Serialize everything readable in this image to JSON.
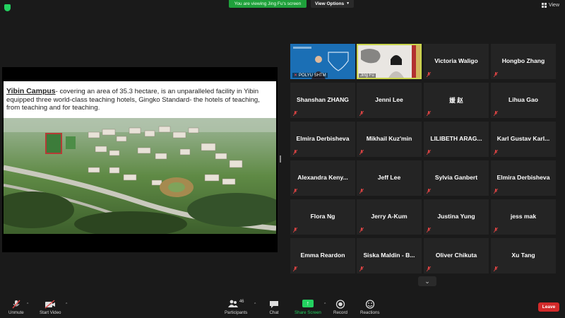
{
  "top_bar": {
    "viewing_banner": "You are viewing Jing Fu's screen",
    "view_options": "View Options",
    "view_label": "View"
  },
  "shared_screen": {
    "slide_title": "Yibin Campus",
    "slide_body": "- covering an area of 35.3 hectare, is an unparalleled facility in Yibin equipped three world-class teaching hotels, Gingko Standard- the hotels of teaching, from teaching and for teaching."
  },
  "participants": {
    "video_tiles": [
      {
        "name": "POLYU SHTM",
        "speaking": false
      },
      {
        "name": "Jing Fu",
        "speaking": true
      }
    ],
    "names": [
      "Victoria Waligo",
      "Hongbo Zhang",
      "Shanshan ZHANG",
      "Jenni Lee",
      "媛 赵",
      "Lihua Gao",
      "Elmira Derbisheva",
      "Mikhail Kuz'min",
      "LILIBETH ARAG...",
      "Karl Gustav Karl...",
      "Alexandra Keny...",
      "Jeff Lee",
      "Sylvia Ganbert",
      "Elmira Derbisheva",
      "Flora Ng",
      "Jerry A-Kum",
      "Justina Yung",
      "jess mak",
      "Emma Reardon",
      "Siska Maldin - B...",
      "Oliver Chikuta",
      "Xu Tang"
    ]
  },
  "toolbar": {
    "unmute": "Unmute",
    "start_video": "Start Video",
    "participants_label": "Participants",
    "participants_count": "46",
    "chat": "Chat",
    "share_screen": "Share Screen",
    "record": "Record",
    "reactions": "Reactions",
    "leave": "Leave"
  },
  "colors": {
    "accent_green": "#23d160",
    "leave_red": "#d32a2a",
    "speaker_outline": "#c9d54d",
    "tile_bg": "#242424"
  }
}
